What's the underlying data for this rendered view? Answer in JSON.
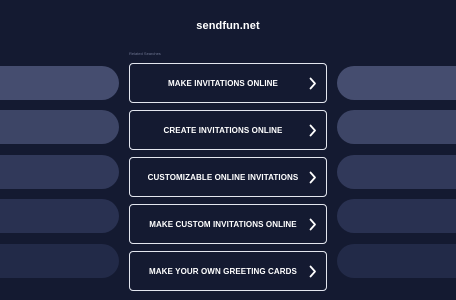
{
  "header": {
    "site_name": "sendfun.net"
  },
  "related": {
    "label": "Related Searches"
  },
  "links": [
    {
      "label": "MAKE INVITATIONS ONLINE",
      "icon": "chevron-right-icon"
    },
    {
      "label": "CREATE INVITATIONS ONLINE",
      "icon": "chevron-right-icon"
    },
    {
      "label": "CUSTOMIZABLE ONLINE INVITATIONS",
      "icon": "chevron-right-icon"
    },
    {
      "label": "MAKE CUSTOM INVITATIONS ONLINE",
      "icon": "chevron-right-icon"
    },
    {
      "label": "MAKE YOUR OWN GREETING CARDS",
      "icon": "chevron-right-icon"
    }
  ],
  "colors": {
    "background": "#141a31",
    "button_border": "#e3e6ef",
    "text": "#ffffff",
    "side_pill_shades": [
      "#454d6f",
      "#3d4566",
      "#31395a",
      "#293151",
      "#222a48"
    ]
  }
}
